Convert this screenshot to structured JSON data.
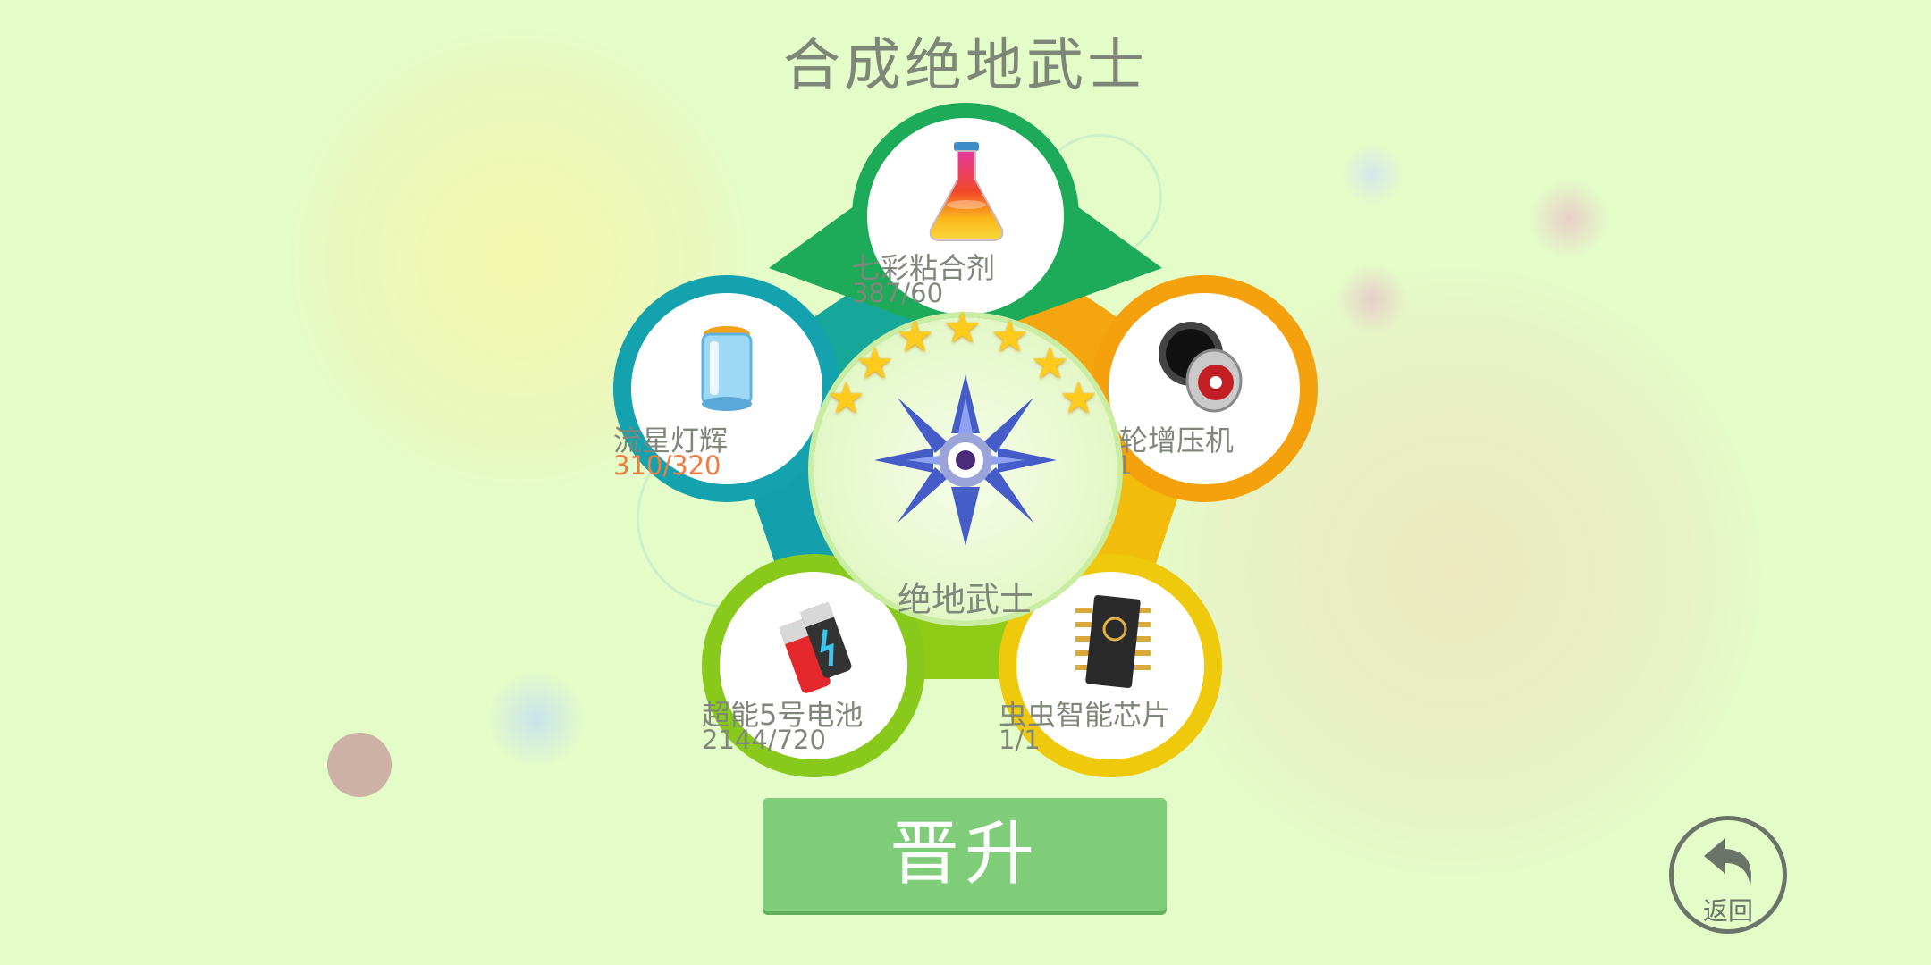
{
  "title": "合成绝地武士",
  "center": {
    "name": "绝地武士",
    "stars": 7,
    "icon": "crystal-warrior-icon"
  },
  "ingredients": [
    {
      "name": "七彩粘合剂",
      "count": "387/60",
      "icon": "rainbow-flask-icon",
      "ring_color": "#1dab5a",
      "sufficient": true
    },
    {
      "name": "流星灯辉",
      "count": "310/320",
      "icon": "lantern-icon",
      "ring_color": "#14a2ae",
      "sufficient": false
    },
    {
      "name": "涡轮增压机",
      "count": "1/1",
      "icon": "turbo-engine-icon",
      "ring_color": "#f4a10d",
      "sufficient": true
    },
    {
      "name": "超能5号电池",
      "count": "2144/720",
      "icon": "battery-icon",
      "ring_color": "#88c91c",
      "sufficient": true
    },
    {
      "name": "虫虫智能芯片",
      "count": "1/1",
      "icon": "chip-icon",
      "ring_color": "#eec90c",
      "sufficient": true
    }
  ],
  "upgrade_button": {
    "label": "晋升"
  },
  "back_button": {
    "label": "返回",
    "icon": "back-arrow-icon"
  },
  "colors": {
    "background": "#e4fcc8",
    "button": "#7fcd78",
    "insufficient_text": "#f47a3d",
    "star": "#ffcc1e"
  }
}
